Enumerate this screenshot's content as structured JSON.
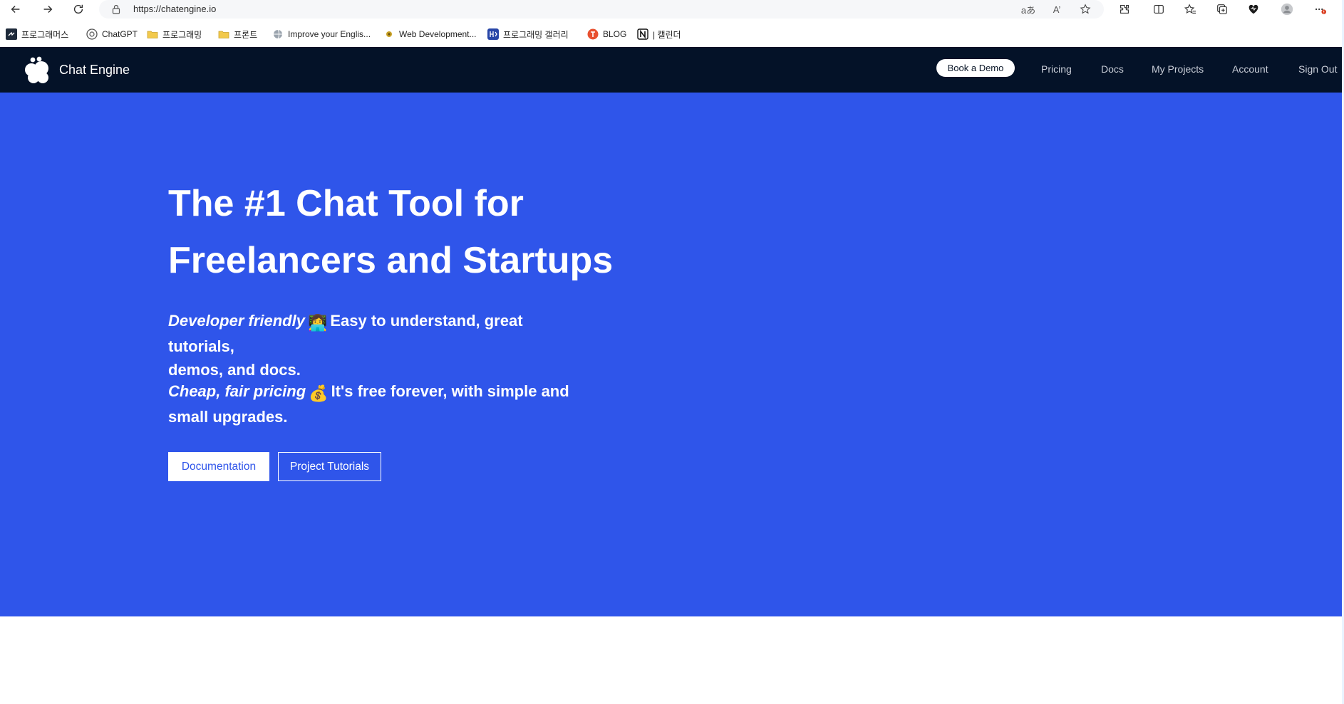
{
  "browser": {
    "url": "https://chatengine.io",
    "bookmarks": [
      {
        "label": "프로그래머스",
        "icon": "programmers-icon"
      },
      {
        "label": "ChatGPT",
        "icon": "chatgpt-icon"
      },
      {
        "label": "프로그래밍",
        "icon": "folder-icon"
      },
      {
        "label": "프론트",
        "icon": "folder-icon"
      },
      {
        "label": "Improve your Englis...",
        "icon": "site-icon"
      },
      {
        "label": "Web Development...",
        "icon": "site-icon"
      },
      {
        "label": "프로그래밍 갤러리",
        "icon": "gallery-icon"
      },
      {
        "label": "BLOG",
        "icon": "blog-icon"
      },
      {
        "label": "| 캘린더",
        "icon": "notion-icon"
      }
    ],
    "translate_glyph": "aあ",
    "read_aloud_glyph": "A’",
    "colors": {
      "toolbar": "#ffffff",
      "address_bar": "#f6f7f9"
    }
  },
  "site": {
    "brand": "Chat Engine",
    "nav": {
      "book_demo": "Book a Demo",
      "pricing": "Pricing",
      "docs": "Docs",
      "my_projects": "My Projects",
      "account": "Account",
      "sign_out": "Sign Out"
    },
    "colors": {
      "header_bg": "#041228",
      "hero_bg": "#2f55ea"
    }
  },
  "hero": {
    "title_line1": "The #1 Chat Tool for",
    "title_line2": "Freelancers and Startups",
    "feature1": {
      "emphasis": "Developer friendly",
      "emoji": "👩‍💻",
      "text_line1": "Easy to understand, great tutorials,",
      "text_line2": "demos, and docs."
    },
    "feature2": {
      "emphasis": "Cheap, fair pricing",
      "emoji": "💰",
      "text_line1": "It's free forever, with simple and",
      "text_line2": "small upgrades."
    },
    "buttons": {
      "documentation": "Documentation",
      "project_tutorials": "Project Tutorials"
    }
  }
}
